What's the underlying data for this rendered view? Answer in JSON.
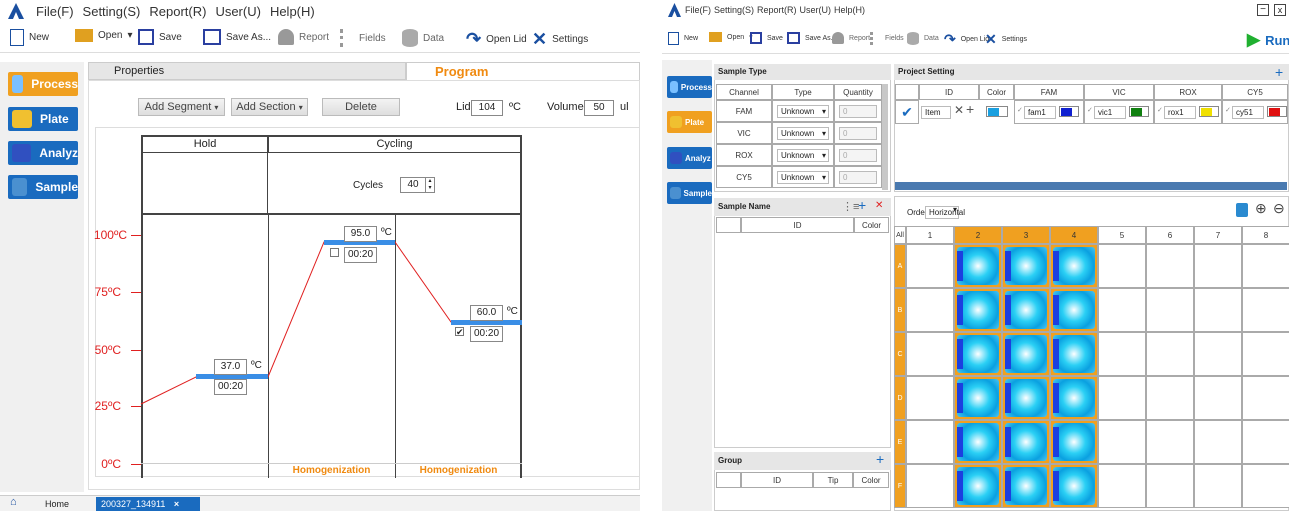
{
  "left": {
    "menu": [
      "File(F)",
      "Setting(S)",
      "Report(R)",
      "User(U)",
      "Help(H)"
    ],
    "toolbar": {
      "new": "New",
      "open": "Open",
      "save": "Save",
      "saveas": "Save As...",
      "report": "Report",
      "fields": "Fields",
      "data": "Data",
      "openlid": "Open Lid",
      "settings": "Settings"
    },
    "nav": [
      "Process",
      "Plate",
      "Analyz",
      "Sample"
    ],
    "tabs": {
      "properties": "Properties",
      "program": "Program"
    },
    "controls": {
      "add_segment": "Add Segment",
      "add_section": "Add Section",
      "delete": "Delete",
      "lid_label": "Lid",
      "lid_value": "104",
      "lid_unit": "ºC",
      "volume_label": "Volume",
      "volume_value": "50",
      "volume_unit": "ul"
    },
    "program": {
      "hold": "Hold",
      "cycling": "Cycling",
      "cycles_label": "Cycles",
      "cycles_value": "40",
      "y_labels": [
        "100ºC",
        "75ºC",
        "50ºC",
        "25ºC",
        "0ºC"
      ],
      "steps": [
        {
          "temp": "37.0",
          "unit": "ºC",
          "time": "00:20"
        },
        {
          "temp": "95.0",
          "unit": "ºC",
          "time": "00:20"
        },
        {
          "temp": "60.0",
          "unit": "ºC",
          "time": "00:20"
        }
      ],
      "homogenization": "Homogenization"
    },
    "statusbar": {
      "home": "Home",
      "tab": "200327_134911",
      "close": "×"
    }
  },
  "right": {
    "menu": [
      "File(F)",
      "Setting(S)",
      "Report(R)",
      "User(U)",
      "Help(H)"
    ],
    "win_min": "−",
    "win_close": "x",
    "toolbar": {
      "new": "New",
      "open": "Open",
      "save": "Save",
      "saveas": "Save As...",
      "report": "Report",
      "fields": "Fields",
      "data": "Data",
      "openlid": "Open Lid",
      "settings": "Settings",
      "run": "Run"
    },
    "nav": [
      "Process",
      "Plate",
      "Analyz",
      "Sample"
    ],
    "sample_type": {
      "title": "Sample Type",
      "headers": [
        "Channel",
        "Type",
        "Quantity"
      ],
      "rows": [
        {
          "channel": "FAM",
          "type": "Unknown",
          "q": "0"
        },
        {
          "channel": "VIC",
          "type": "Unknown",
          "q": "0"
        },
        {
          "channel": "ROX",
          "type": "Unknown",
          "q": "0"
        },
        {
          "channel": "CY5",
          "type": "Unknown",
          "q": "0"
        }
      ]
    },
    "project": {
      "title": "Project Setting",
      "plus": "+",
      "headers": [
        "ID",
        "Color",
        "FAM",
        "VIC",
        "ROX",
        "CY5"
      ],
      "row": {
        "id": "Item",
        "fam": "fam1",
        "vic": "vic1",
        "rox": "rox1",
        "cy5": "cy51"
      },
      "colors": {
        "item": "#1aa0e0",
        "fam": "#1020d0",
        "vic": "#108010",
        "rox": "#f0e000",
        "cy5": "#e01010"
      }
    },
    "sample_name": {
      "title": "Sample Name",
      "headers": [
        "ID",
        "Color"
      ]
    },
    "group": {
      "title": "Group",
      "headers": [
        "ID",
        "Tip",
        "Color"
      ],
      "plus": "+"
    },
    "plate": {
      "order_label": "Order",
      "order_value": "Horizontal",
      "all": "All",
      "cols": [
        "1",
        "2",
        "3",
        "4",
        "5",
        "6",
        "7",
        "8"
      ],
      "rows": [
        "A",
        "B",
        "C",
        "D",
        "E",
        "F"
      ]
    }
  }
}
